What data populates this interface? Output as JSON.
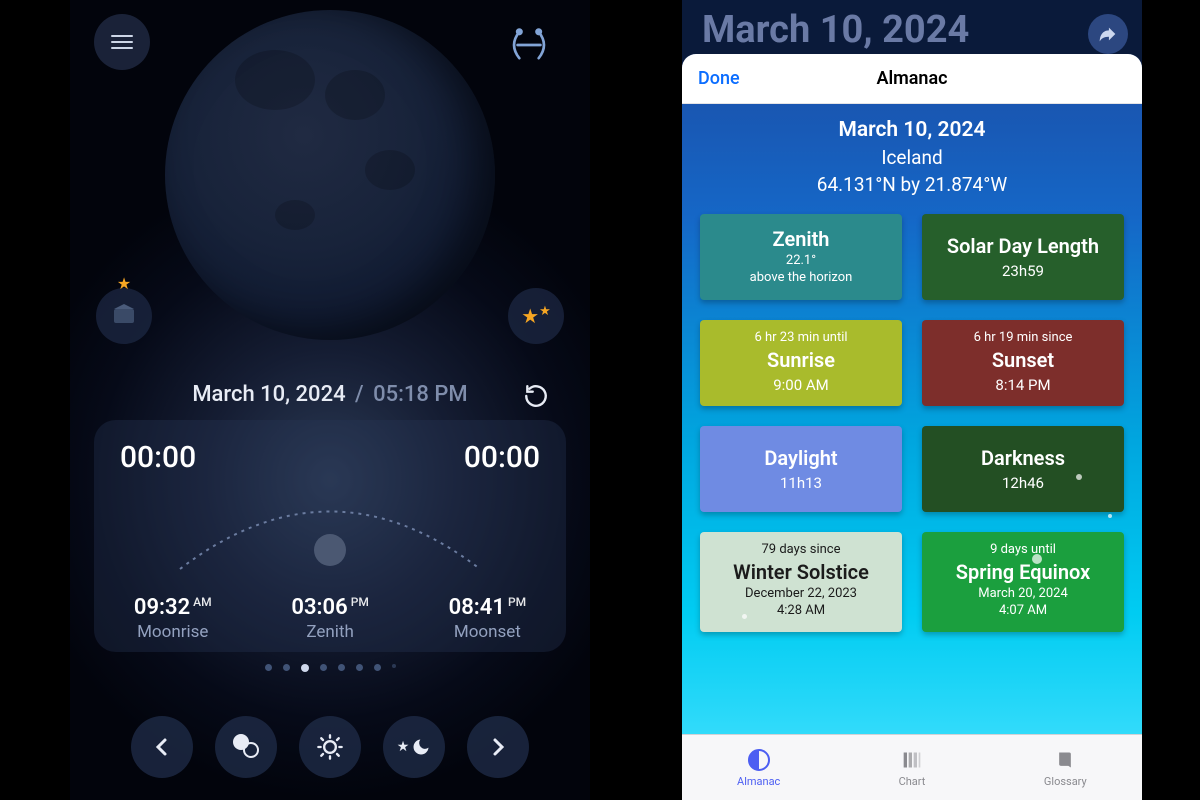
{
  "left": {
    "date": "March 10, 2024",
    "time": "05:18 PM",
    "zodiac_icon": "pisces-icon",
    "arc_start": "00:00",
    "arc_end": "00:00",
    "events": {
      "moonrise": {
        "label": "Moonrise",
        "time": "09:32",
        "ampm": "AM"
      },
      "zenith": {
        "label": "Zenith",
        "time": "03:06",
        "ampm": "PM"
      },
      "moonset": {
        "label": "Moonset",
        "time": "08:41",
        "ampm": "PM"
      }
    },
    "page_dots": {
      "count": 7,
      "active_index": 2
    },
    "bottom_icons": [
      "prev",
      "phase",
      "sun",
      "favorite-night",
      "next"
    ]
  },
  "right": {
    "background_title": "March 10, 2024",
    "sheet": {
      "done_label": "Done",
      "title": "Almanac",
      "date": "March 10, 2024",
      "place": "Iceland",
      "coords": "64.131°N by 21.874°W",
      "tiles": {
        "zenith": {
          "title": "Zenith",
          "val1": "22.1°",
          "val2": "above the horizon"
        },
        "solday": {
          "title": "Solar Day Length",
          "val1": "23h59"
        },
        "sunrise": {
          "pre": "6 hr 23 min until",
          "title": "Sunrise",
          "val1": "9:00 AM"
        },
        "sunset": {
          "pre": "6 hr 19 min since",
          "title": "Sunset",
          "val1": "8:14 PM"
        },
        "daylight": {
          "title": "Daylight",
          "val1": "11h13"
        },
        "darkness": {
          "title": "Darkness",
          "val1": "12h46"
        },
        "winter": {
          "pre": "79 days since",
          "title": "Winter Solstice",
          "val1": "December 22, 2023",
          "val2": "4:28 AM"
        },
        "spring": {
          "pre": "9 days until",
          "title": "Spring Equinox",
          "val1": "March 20, 2024",
          "val2": "4:07 AM"
        }
      }
    },
    "tabs": {
      "almanac": "Almanac",
      "chart": "Chart",
      "glossary": "Glossary",
      "active": "almanac"
    }
  }
}
